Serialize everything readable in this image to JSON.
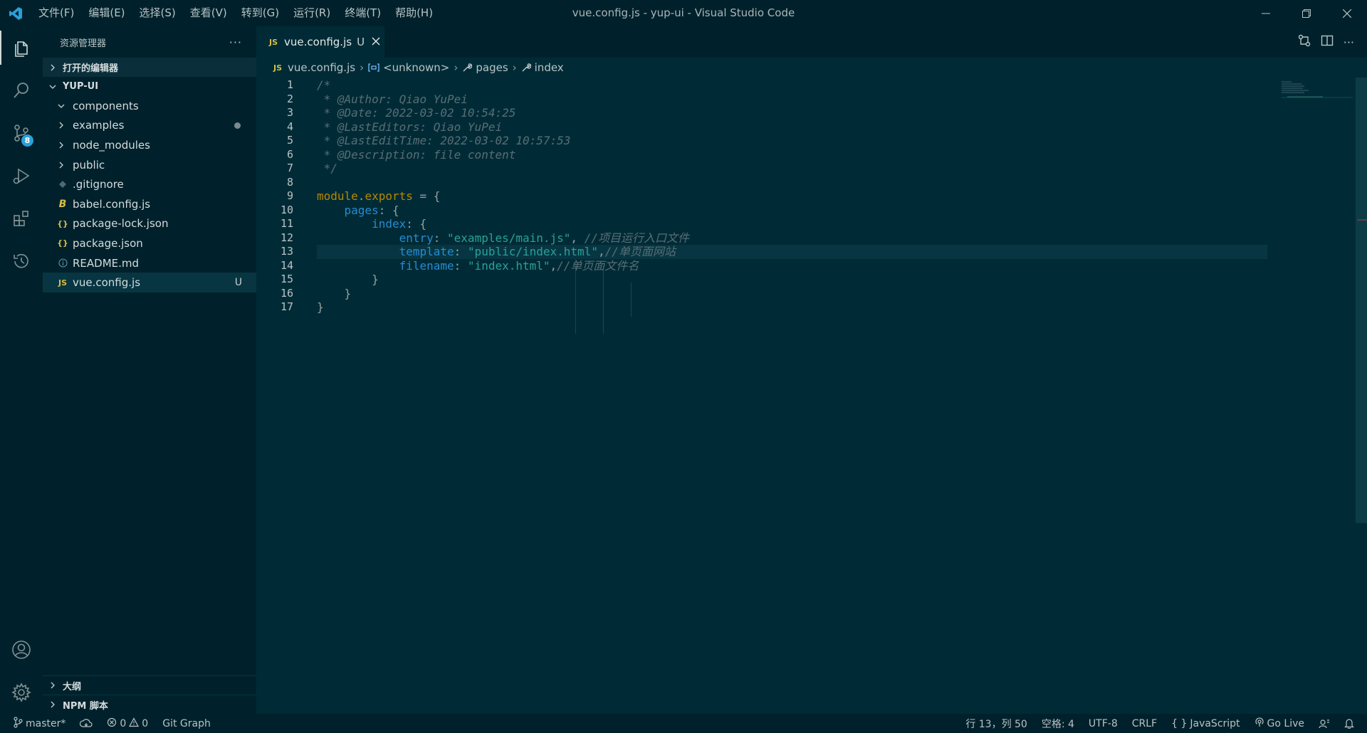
{
  "window": {
    "title": "vue.config.js - yup-ui - Visual Studio Code",
    "menu": [
      "文件(F)",
      "编辑(E)",
      "选择(S)",
      "查看(V)",
      "转到(G)",
      "运行(R)",
      "终端(T)",
      "帮助(H)"
    ]
  },
  "activity_bar": {
    "scm_badge": "8"
  },
  "sidebar": {
    "title": "资源管理器",
    "more": "···",
    "open_editors": "打开的编辑器",
    "root": "YUP-UI",
    "items": [
      {
        "label": "components",
        "kind": "folder-open"
      },
      {
        "label": "examples",
        "kind": "folder",
        "dot": true
      },
      {
        "label": "node_modules",
        "kind": "folder"
      },
      {
        "label": "public",
        "kind": "folder"
      },
      {
        "label": ".gitignore",
        "kind": "git-icon"
      },
      {
        "label": "babel.config.js",
        "kind": "babel-icon"
      },
      {
        "label": "package-lock.json",
        "kind": "json-icon"
      },
      {
        "label": "package.json",
        "kind": "json-icon"
      },
      {
        "label": "README.md",
        "kind": "info-icon"
      },
      {
        "label": "vue.config.js",
        "kind": "js-icon",
        "status": "U"
      }
    ],
    "outline": "大纲",
    "npm_scripts": "NPM 脚本"
  },
  "tabs": [
    {
      "icon_text": "JS",
      "label": "vue.config.js",
      "status": "U"
    }
  ],
  "breadcrumb": {
    "file_icon": "JS",
    "file": "vue.config.js",
    "items": [
      "<unknown>",
      "pages",
      "index"
    ]
  },
  "code": {
    "lines": [
      {
        "n": "1",
        "parts": [
          {
            "c": "cm",
            "t": "/*"
          }
        ]
      },
      {
        "n": "2",
        "parts": [
          {
            "c": "cm",
            "t": " * @Author: Qiao YuPei"
          }
        ]
      },
      {
        "n": "3",
        "parts": [
          {
            "c": "cm",
            "t": " * @Date: 2022-03-02 10:54:25"
          }
        ]
      },
      {
        "n": "4",
        "parts": [
          {
            "c": "cm",
            "t": " * @LastEditors: Qiao YuPei"
          }
        ]
      },
      {
        "n": "5",
        "parts": [
          {
            "c": "cm",
            "t": " * @LastEditTime: 2022-03-02 10:57:53"
          }
        ]
      },
      {
        "n": "6",
        "parts": [
          {
            "c": "cm",
            "t": " * @Description: file content"
          }
        ]
      },
      {
        "n": "7",
        "parts": [
          {
            "c": "cm",
            "t": " */"
          }
        ]
      },
      {
        "n": "8",
        "parts": []
      },
      {
        "n": "9",
        "parts": [
          {
            "c": "kw",
            "t": "module"
          },
          {
            "c": "pn",
            "t": "."
          },
          {
            "c": "kw",
            "t": "exports"
          },
          {
            "c": "pn",
            "t": " = {"
          }
        ]
      },
      {
        "n": "10",
        "parts": [
          {
            "c": "pn",
            "t": "    "
          },
          {
            "c": "prop",
            "t": "pages"
          },
          {
            "c": "pn",
            "t": ": {"
          }
        ]
      },
      {
        "n": "11",
        "parts": [
          {
            "c": "pn",
            "t": "        "
          },
          {
            "c": "prop",
            "t": "index"
          },
          {
            "c": "pn",
            "t": ": {"
          }
        ]
      },
      {
        "n": "12",
        "parts": [
          {
            "c": "pn",
            "t": "            "
          },
          {
            "c": "prop",
            "t": "entry"
          },
          {
            "c": "pn",
            "t": ": "
          },
          {
            "c": "str",
            "t": "\"examples/main.js\""
          },
          {
            "c": "pn",
            "t": ", "
          },
          {
            "c": "cm",
            "t": "//项目运行入口文件"
          }
        ]
      },
      {
        "n": "13",
        "parts": [
          {
            "c": "pn",
            "t": "            "
          },
          {
            "c": "prop",
            "t": "template"
          },
          {
            "c": "pn",
            "t": ": "
          },
          {
            "c": "str",
            "t": "\"public/index.html\""
          },
          {
            "c": "pn",
            "t": ","
          },
          {
            "c": "cm",
            "t": "//单页面网站"
          }
        ],
        "current": true
      },
      {
        "n": "14",
        "parts": [
          {
            "c": "pn",
            "t": "            "
          },
          {
            "c": "prop",
            "t": "filename"
          },
          {
            "c": "pn",
            "t": ": "
          },
          {
            "c": "str",
            "t": "\"index.html\""
          },
          {
            "c": "pn",
            "t": ","
          },
          {
            "c": "cm",
            "t": "//单页面文件名"
          }
        ]
      },
      {
        "n": "15",
        "parts": [
          {
            "c": "pn",
            "t": "        }"
          }
        ]
      },
      {
        "n": "16",
        "parts": [
          {
            "c": "pn",
            "t": "    }"
          }
        ]
      },
      {
        "n": "17",
        "parts": [
          {
            "c": "pn",
            "t": "}"
          }
        ]
      }
    ]
  },
  "statusbar": {
    "branch": "master*",
    "errors": "0",
    "warnings": "0",
    "git_graph": "Git Graph",
    "cursor": "行 13，列 50",
    "spaces": "空格: 4",
    "encoding": "UTF-8",
    "eol": "CRLF",
    "language": "JavaScript",
    "go_live": "Go Live"
  },
  "colors": {
    "background": "#002b36",
    "sidebar": "#00212b",
    "current_line": "#073642",
    "comment": "#586e75",
    "keyword": "#b58900",
    "property": "#268bd2",
    "string": "#2aa198",
    "js_badge": "#d5bd48",
    "scm_badge": "#2aa1d9"
  }
}
